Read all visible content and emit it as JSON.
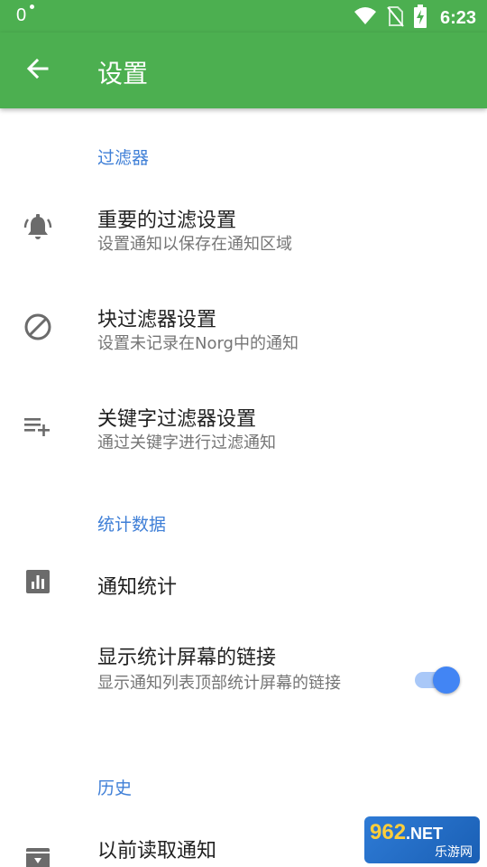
{
  "status_bar": {
    "left_indicator": "0",
    "time": "6:23",
    "icons": [
      "wifi-icon",
      "no-sim-icon",
      "battery-charging-icon"
    ]
  },
  "app_bar": {
    "title": "设置",
    "back_icon": "arrow-back-icon",
    "background_color": "#4caf50"
  },
  "sections": {
    "filter": {
      "header": "过滤器",
      "important": {
        "title": "重要的过滤设置",
        "subtitle": "设置通知以保存在通知区域",
        "icon": "bell-ring-icon"
      },
      "block": {
        "title": "块过滤器设置",
        "subtitle": "设置未记录在Norg中的通知",
        "icon": "block-icon"
      },
      "keyword": {
        "title": "关键字过滤器设置",
        "subtitle": "通过关键字进行过滤通知",
        "icon": "playlist-add-icon"
      }
    },
    "stats": {
      "header": "统计数据",
      "notification_stats": {
        "title": "通知统计",
        "icon": "bar-chart-icon"
      },
      "show_link": {
        "title": "显示统计屏幕的链接",
        "subtitle": "显示通知列表顶部统计屏幕的链接",
        "toggle_on": true
      }
    },
    "history": {
      "header": "历史",
      "previous_read": {
        "title": "以前读取通知",
        "icon": "archive-download-icon"
      }
    }
  },
  "colors": {
    "accent": "#3f7fd7",
    "toggle": "#4285f4"
  },
  "watermark": {
    "main": "962",
    "net": ".NET",
    "sub": "乐游网"
  }
}
